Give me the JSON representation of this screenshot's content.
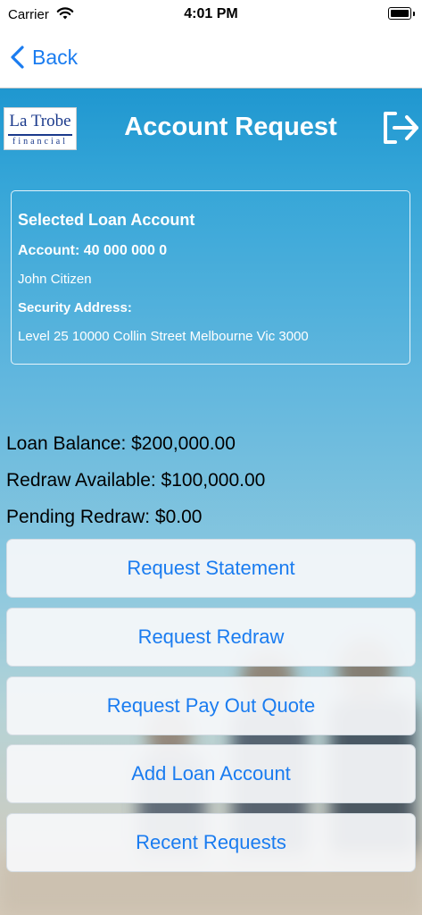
{
  "status_bar": {
    "carrier": "Carrier",
    "time": "4:01 PM",
    "icons": [
      "wifi-icon",
      "battery-icon"
    ]
  },
  "nav": {
    "back_label": "Back",
    "back_icon": "chevron-left-icon",
    "accent_color": "#1a7cf0"
  },
  "header": {
    "logo_line1": "La Trobe",
    "logo_line2": "financial",
    "title": "Account Request",
    "logout_icon": "logout-arrow-icon"
  },
  "account_card": {
    "title": "Selected Loan Account",
    "account": "Account: 40 000 000 0",
    "name": "John Citizen",
    "security_label": "Security Address:",
    "address": "Level 25 10000 Collin Street Melbourne Vic 3000"
  },
  "summary": {
    "loan_balance": "Loan Balance: $200,000.00",
    "redraw_available": "Redraw Available: $100,000.00",
    "pending_redraw": "Pending Redraw: $0.00"
  },
  "actions": [
    {
      "label": "Request Statement"
    },
    {
      "label": "Request Redraw"
    },
    {
      "label": "Request Pay Out Quote"
    },
    {
      "label": "Add Loan Account"
    },
    {
      "label": "Recent Requests"
    }
  ],
  "colors": {
    "header_blue": "#1f97d0",
    "button_text": "#1a7cf0"
  }
}
